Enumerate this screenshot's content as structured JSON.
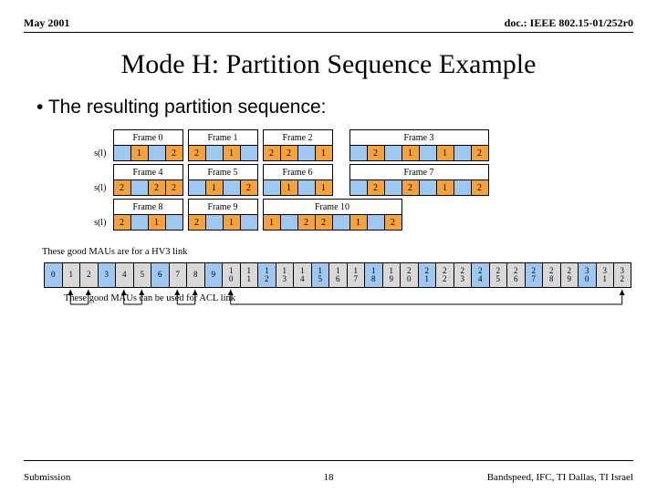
{
  "header": {
    "date": "May 2001",
    "doc": "doc.: IEEE 802.15-01/252r0"
  },
  "title": "Mode H: Partition Sequence Example",
  "bullet": "The resulting partition sequence:",
  "note_top": "These good MAUs are for a HV3 link",
  "note_bottom": "These good MAUs can be used for ACL link",
  "footer": {
    "left": "Submission",
    "page": "18",
    "right": "Bandspeed, IFC, TI Dallas, TI Israel"
  },
  "chart_data": {
    "type": "table",
    "partition_rows": [
      {
        "label": "s(l)",
        "groups": [
          {
            "header": "Frame 0",
            "cells": [
              {
                "v": "",
                "c": "blue"
              },
              {
                "v": "1",
                "c": "ora"
              },
              {
                "v": "",
                "c": "blue"
              },
              {
                "v": "2",
                "c": "ora"
              }
            ]
          },
          {
            "header": "Frame 1",
            "cells": [
              {
                "v": "2",
                "c": "ora"
              },
              {
                "v": "",
                "c": "blue"
              },
              {
                "v": "1",
                "c": "ora"
              },
              {
                "v": "",
                "c": "blue"
              }
            ]
          },
          {
            "header": "Frame 2",
            "cells": [
              {
                "v": "2",
                "c": "ora"
              },
              {
                "v": "2",
                "c": "ora"
              },
              {
                "v": "",
                "c": "blue"
              },
              {
                "v": "1",
                "c": "ora"
              }
            ]
          },
          {
            "header": "Frame 3",
            "cells": [
              {
                "v": "",
                "c": "blue"
              },
              {
                "v": "2",
                "c": "ora"
              },
              {
                "v": "",
                "c": "blue"
              },
              {
                "v": "1",
                "c": "ora"
              },
              {
                "v": "",
                "c": "blue"
              },
              {
                "v": "1",
                "c": "ora"
              },
              {
                "v": "",
                "c": "blue"
              },
              {
                "v": "2",
                "c": "ora"
              }
            ]
          }
        ]
      },
      {
        "label": "s(l)",
        "groups": [
          {
            "header": "Frame 4",
            "cells": [
              {
                "v": "2",
                "c": "ora"
              },
              {
                "v": "",
                "c": "blue"
              },
              {
                "v": "2",
                "c": "ora"
              },
              {
                "v": "2",
                "c": "ora"
              }
            ]
          },
          {
            "header": "Frame 5",
            "cells": [
              {
                "v": "",
                "c": "blue"
              },
              {
                "v": "1",
                "c": "ora"
              },
              {
                "v": "",
                "c": "blue"
              },
              {
                "v": "2",
                "c": "ora"
              }
            ]
          },
          {
            "header": "Frame 6",
            "cells": [
              {
                "v": "",
                "c": "blue"
              },
              {
                "v": "1",
                "c": "ora"
              },
              {
                "v": "",
                "c": "blue"
              },
              {
                "v": "1",
                "c": "ora"
              }
            ]
          },
          {
            "header": "Frame 7",
            "cells": [
              {
                "v": "",
                "c": "blue"
              },
              {
                "v": "2",
                "c": "ora"
              },
              {
                "v": "",
                "c": "blue"
              },
              {
                "v": "2",
                "c": "ora"
              },
              {
                "v": "",
                "c": "blue"
              },
              {
                "v": "1",
                "c": "ora"
              },
              {
                "v": "",
                "c": "blue"
              },
              {
                "v": "2",
                "c": "ora"
              }
            ]
          }
        ]
      },
      {
        "label": "s(l)",
        "groups": [
          {
            "header": "Frame 8",
            "cells": [
              {
                "v": "2",
                "c": "ora"
              },
              {
                "v": "",
                "c": "blue"
              },
              {
                "v": "1",
                "c": "ora"
              },
              {
                "v": "",
                "c": "blue"
              }
            ]
          },
          {
            "header": "Frame 9",
            "cells": [
              {
                "v": "2",
                "c": "ora"
              },
              {
                "v": "",
                "c": "blue"
              },
              {
                "v": "1",
                "c": "ora"
              },
              {
                "v": "",
                "c": "blue"
              }
            ]
          },
          {
            "header": "Frame 10",
            "cells": [
              {
                "v": "1",
                "c": "ora"
              },
              {
                "v": "",
                "c": "blue"
              },
              {
                "v": "2",
                "c": "ora"
              },
              {
                "v": "2",
                "c": "ora"
              },
              {
                "v": "",
                "c": "blue"
              },
              {
                "v": "1",
                "c": "ora"
              },
              {
                "v": "",
                "c": "blue"
              },
              {
                "v": "2",
                "c": "ora"
              }
            ]
          }
        ]
      }
    ],
    "slot_strip": {
      "slots": [
        0,
        1,
        2,
        3,
        4,
        5,
        6,
        7,
        8,
        9,
        10,
        11,
        12,
        13,
        14,
        15,
        16,
        17,
        18,
        19,
        20,
        21,
        22,
        23,
        24,
        25,
        26,
        27,
        28,
        29,
        30,
        31,
        32
      ],
      "blue_indices": [
        0,
        3,
        6,
        9,
        12,
        15,
        18,
        21,
        24,
        27,
        30
      ],
      "arrows": [
        {
          "from": 1,
          "to": 2
        },
        {
          "from": 4,
          "to": 5
        },
        {
          "from": 7,
          "to": 8
        },
        {
          "from": 10,
          "to": 32
        }
      ]
    }
  }
}
